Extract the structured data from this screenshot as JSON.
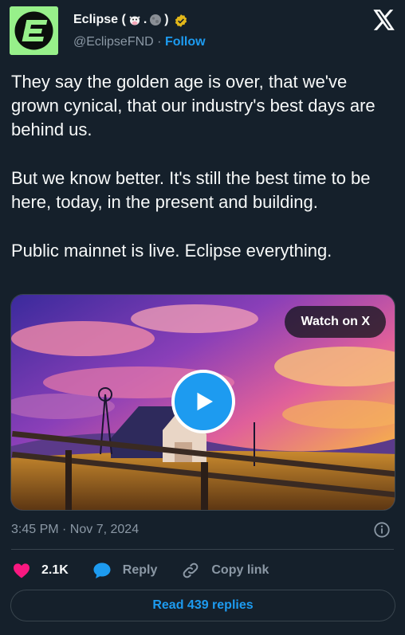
{
  "author": {
    "name": "Eclipse (",
    "name_suffix": ")",
    "name_separator": ".",
    "handle": "@EclipseFND",
    "separator": "·",
    "follow_label": "Follow",
    "avatar_color": "#97f08a"
  },
  "tweet": {
    "paragraphs": [
      "They say the golden age is over, that we've grown cynical, that our industry's best days are behind us.",
      "But we know better. It's still the best time to be here, today, in the present and building.",
      "Public mainnet is live. Eclipse everything."
    ]
  },
  "media": {
    "watch_label": "Watch on X"
  },
  "meta": {
    "timestamp": "3:45 PM · Nov 7, 2024"
  },
  "actions": {
    "like_count": "2.1K",
    "reply_label": "Reply",
    "copy_link_label": "Copy link"
  },
  "footer": {
    "read_replies_label": "Read 439 replies"
  },
  "colors": {
    "background": "#15202b",
    "accent": "#1d9bf0",
    "like": "#f91880",
    "verified": "#e2b719"
  }
}
